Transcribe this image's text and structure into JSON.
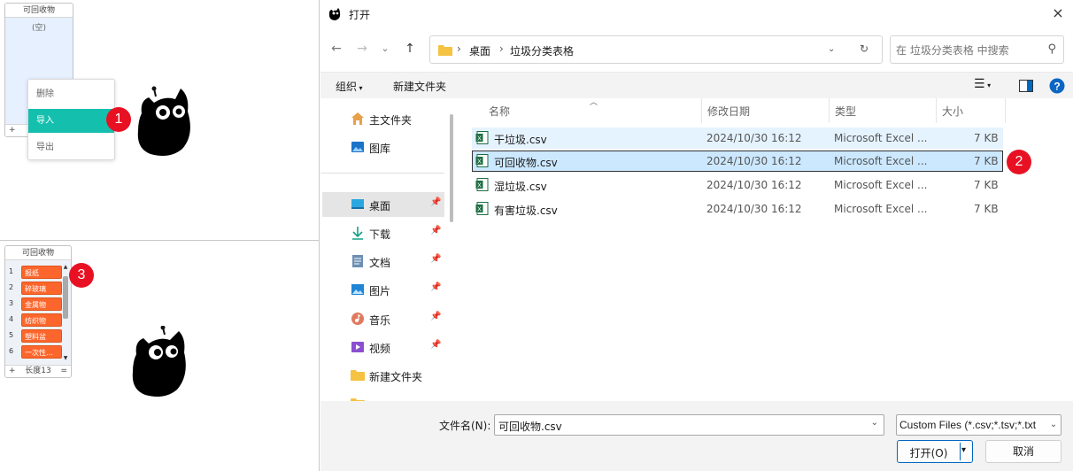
{
  "scratch": {
    "top_list": {
      "title": "可回收物",
      "empty_text": "(空)",
      "add": "+"
    },
    "context_menu": {
      "items": [
        "删除",
        "导入",
        "导出"
      ],
      "selected": "导入"
    },
    "bottom_list": {
      "title": "可回收物",
      "items": [
        {
          "index": "1",
          "value": "报纸"
        },
        {
          "index": "2",
          "value": "碎玻璃"
        },
        {
          "index": "3",
          "value": "金属物"
        },
        {
          "index": "4",
          "value": "纺织物"
        },
        {
          "index": "5",
          "value": "塑料盆"
        },
        {
          "index": "6",
          "value": "一次性…"
        }
      ],
      "add": "+",
      "length_label": "长度13",
      "resize": "="
    },
    "badges": [
      "1",
      "2",
      "3"
    ]
  },
  "dialog": {
    "title": "打开",
    "close": "×",
    "nav": {
      "back": "←",
      "forward": "→",
      "recent": "⌄",
      "up": "↑",
      "refresh": "↻",
      "history": "⌄"
    },
    "breadcrumb": [
      "桌面",
      "垃圾分类表格"
    ],
    "search_placeholder": "在 垃圾分类表格 中搜索",
    "toolbar": {
      "organize": "组织",
      "new_folder": "新建文件夹"
    },
    "sidebar": {
      "items": [
        {
          "label": "主文件夹",
          "icon": "home-icon",
          "pinned": false
        },
        {
          "label": "图库",
          "icon": "gallery-icon",
          "pinned": false
        },
        {
          "label": "桌面",
          "icon": "desktop-icon",
          "pinned": true
        },
        {
          "label": "下载",
          "icon": "download-icon",
          "pinned": true
        },
        {
          "label": "文档",
          "icon": "document-icon",
          "pinned": true
        },
        {
          "label": "图片",
          "icon": "pictures-icon",
          "pinned": true
        },
        {
          "label": "音乐",
          "icon": "music-icon",
          "pinned": true
        },
        {
          "label": "视频",
          "icon": "video-icon",
          "pinned": true
        },
        {
          "label": "新建文件夹",
          "icon": "folder-icon",
          "pinned": false
        }
      ],
      "selected": "桌面"
    },
    "columns": {
      "name": "名称",
      "date": "修改日期",
      "type": "类型",
      "size": "大小"
    },
    "files": [
      {
        "name": "干垃圾.csv",
        "date": "2024/10/30 16:12",
        "type": "Microsoft Excel ...",
        "size": "7 KB"
      },
      {
        "name": "可回收物.csv",
        "date": "2024/10/30 16:12",
        "type": "Microsoft Excel ...",
        "size": "7 KB"
      },
      {
        "name": "湿垃圾.csv",
        "date": "2024/10/30 16:12",
        "type": "Microsoft Excel ...",
        "size": "7 KB"
      },
      {
        "name": "有害垃圾.csv",
        "date": "2024/10/30 16:12",
        "type": "Microsoft Excel ...",
        "size": "7 KB"
      }
    ],
    "selected_file": "可回收物.csv",
    "filename_label": "文件名(N):",
    "filename_value": "可回收物.csv",
    "filter": "Custom Files (*.csv;*.tsv;*.txt",
    "open_label": "打开(O)",
    "cancel_label": "取消"
  },
  "colors": {
    "accent": "#0067c0",
    "menu_selected": "#15bfae",
    "list_item": "#fc662c",
    "badge": "#e81123",
    "selection": "#cce8ff"
  }
}
